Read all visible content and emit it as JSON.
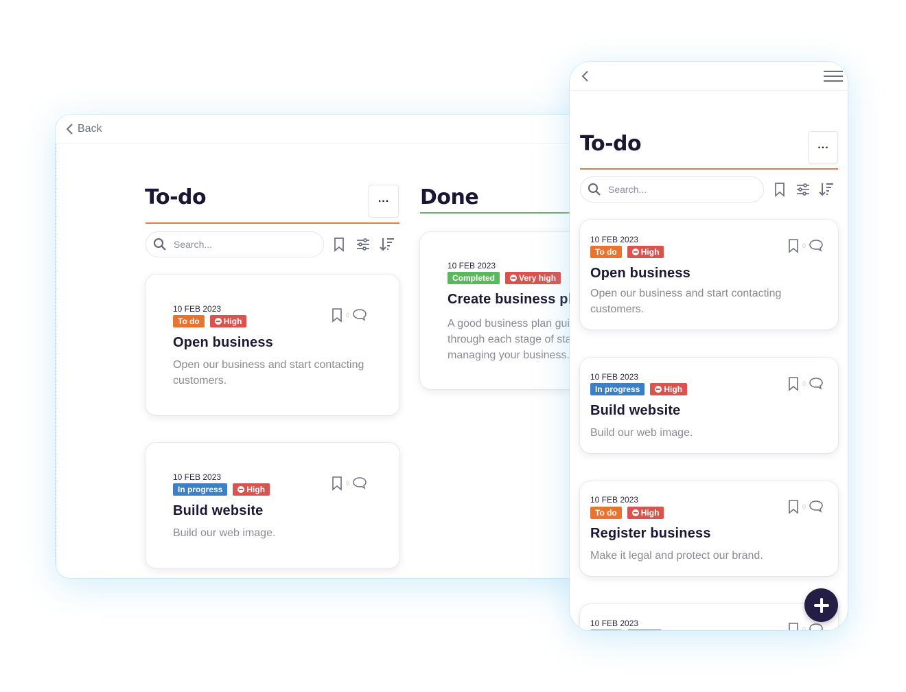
{
  "colors": {
    "todo_orange": "#ee7a3a",
    "done_green": "#5cb85c",
    "badge_todo": "#e8742f",
    "badge_high": "#d9534f",
    "badge_inprogress": "#3d7fc4",
    "badge_completed": "#5cb85c",
    "fab": "#241d45"
  },
  "desktop": {
    "back_label": "Back",
    "columns": [
      {
        "title": "To-do",
        "more_label": "...",
        "search_placeholder": "Search...",
        "cards": [
          {
            "date": "10 FEB 2023",
            "status": "To do",
            "priority": "High",
            "title": "Open business",
            "description": "Open our business and start contacting customers.",
            "comments": "0"
          },
          {
            "date": "10 FEB 2023",
            "status": "In progress",
            "priority": "High",
            "title": "Build website",
            "description": "Build our web image.",
            "comments": "0"
          }
        ]
      },
      {
        "title": "Done",
        "cards": [
          {
            "date": "10 FEB 2023",
            "status": "Completed",
            "priority": "Very high",
            "title": "Create business plan",
            "description": "A good business plan guides you through each stage of starting and managing your business."
          }
        ]
      }
    ]
  },
  "mobile": {
    "title": "To-do",
    "more_label": "...",
    "search_placeholder": "Search...",
    "cards": [
      {
        "date": "10 FEB 2023",
        "status": "To do",
        "priority": "High",
        "title": "Open business",
        "description": "Open our business and start contacting customers.",
        "comments": "0"
      },
      {
        "date": "10 FEB 2023",
        "status": "In progress",
        "priority": "High",
        "title": "Build website",
        "description": "Build our web image.",
        "comments": "0"
      },
      {
        "date": "10 FEB 2023",
        "status": "To do",
        "priority": "High",
        "title": "Register business",
        "description": "Make it legal and protect our brand.",
        "comments": "0"
      },
      {
        "date": "10 FEB 2023",
        "comments": "0"
      }
    ],
    "icons": [
      "chevron-left-icon",
      "hamburger-menu-icon",
      "search-icon",
      "bookmark-icon",
      "sliders-icon",
      "sort-icon",
      "comment-icon",
      "plus-icon"
    ]
  }
}
